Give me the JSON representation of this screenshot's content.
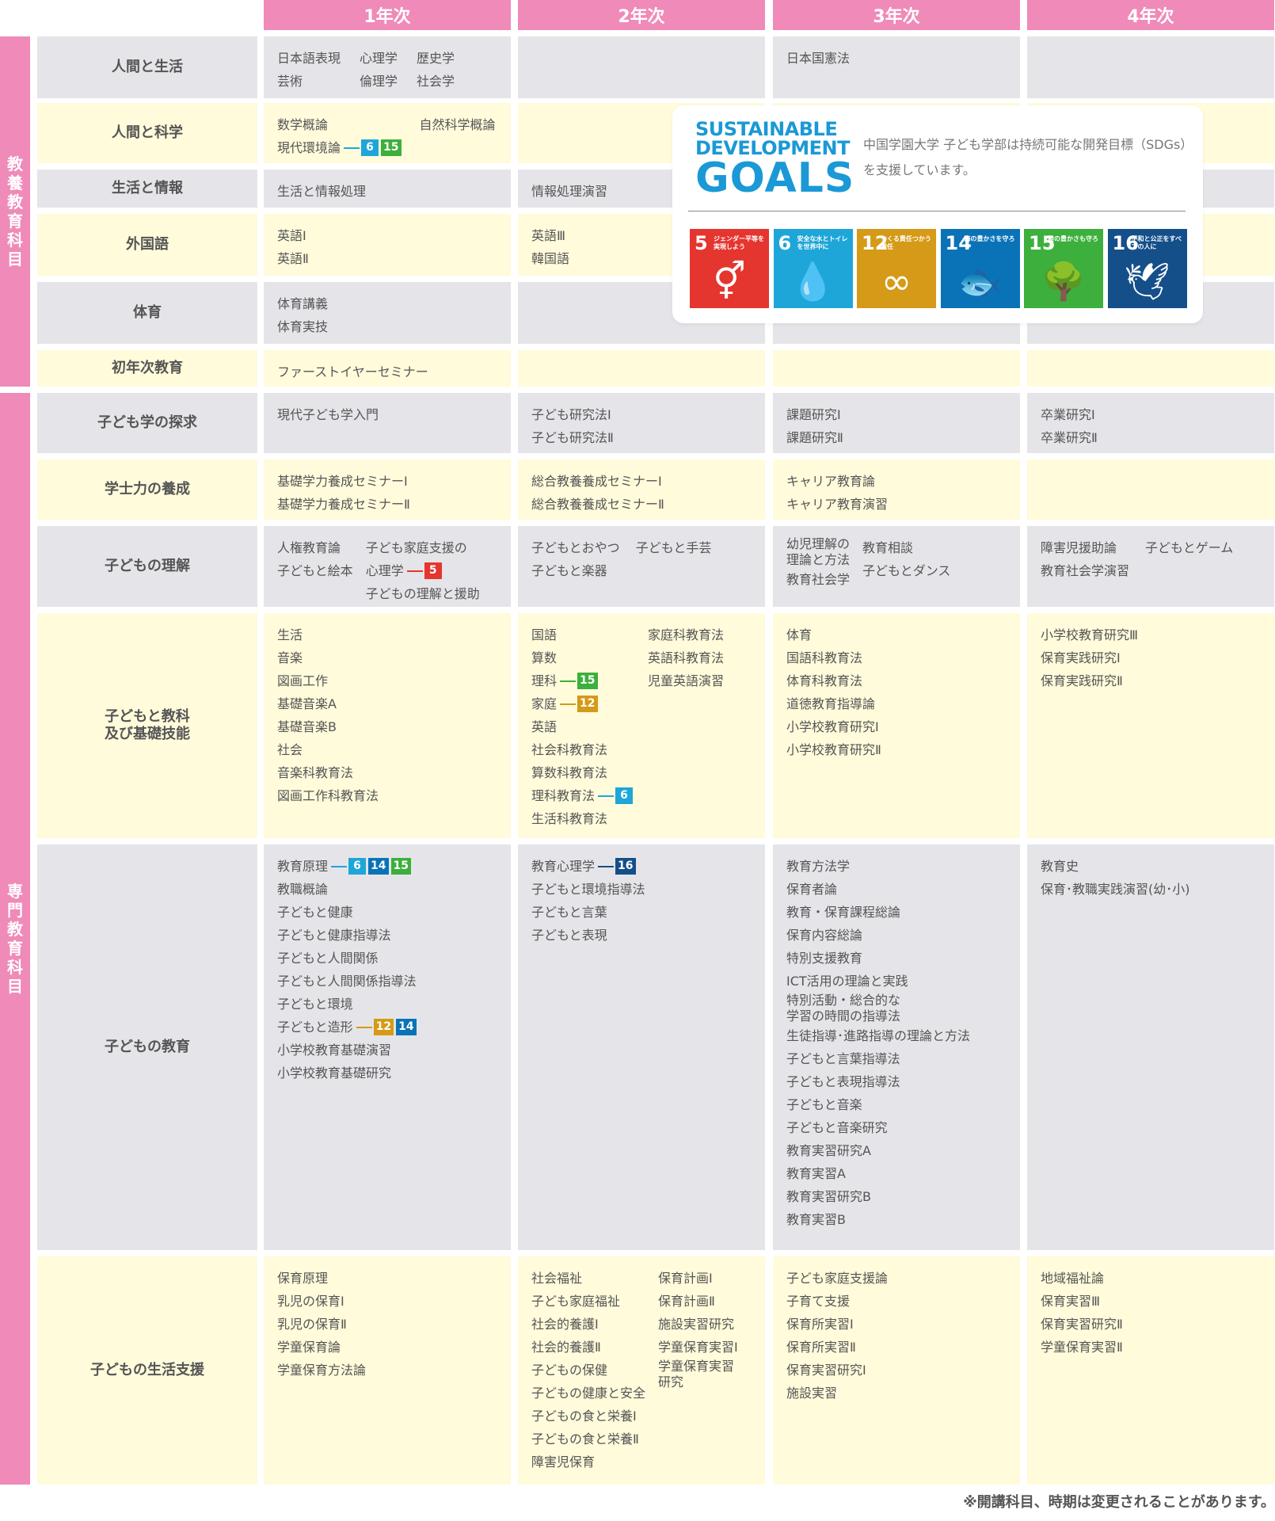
{
  "years": [
    "1年次",
    "2年次",
    "3年次",
    "4年次"
  ],
  "groups": {
    "general": "教養教育科目",
    "specialized": "専門教育科目"
  },
  "colors": {
    "pink": "#ef8ab9",
    "gray_cell": "#e5e5e9",
    "cream_cell": "#fffbdb",
    "sdg5": "#e5352f",
    "sdg6": "#1ea6d9",
    "sdg12": "#d59a17",
    "sdg14": "#0a73b8",
    "sdg15": "#3caf3c",
    "sdg16": "#144f8a"
  },
  "rows": [
    {
      "category": "人間と生活",
      "tone": "gray",
      "y1": {
        "layout": "grid3",
        "items": [
          {
            "t": "日本語表現"
          },
          {
            "t": "心理学"
          },
          {
            "t": "歴史学"
          },
          {
            "t": "芸術"
          },
          {
            "t": "倫理学"
          },
          {
            "t": "社会学"
          }
        ]
      },
      "y2": null,
      "y3": {
        "items": [
          {
            "t": "日本国憲法"
          }
        ]
      },
      "y4": null
    },
    {
      "category": "人間と科学",
      "tone": "cream",
      "y1": {
        "layout": "grid2",
        "items": [
          {
            "t": "数学概論"
          },
          {
            "t": "自然科学概論"
          },
          {
            "t": "現代環境論",
            "s": [
              "6",
              "15"
            ]
          }
        ]
      },
      "y2": null,
      "y3": null,
      "y4": null
    },
    {
      "category": "生活と情報",
      "tone": "gray",
      "y1": {
        "items": [
          {
            "t": "生活と情報処理"
          }
        ]
      },
      "y2": {
        "items": [
          {
            "t": "情報処理演習"
          }
        ]
      },
      "y3": null,
      "y4": null
    },
    {
      "category": "外国語",
      "tone": "cream",
      "y1": {
        "items": [
          {
            "t": "英語Ⅰ"
          },
          {
            "t": "英語Ⅱ"
          }
        ]
      },
      "y2": {
        "items": [
          {
            "t": "英語Ⅲ"
          },
          {
            "t": "韓国語"
          }
        ]
      },
      "y3": null,
      "y4": null
    },
    {
      "category": "体育",
      "tone": "gray",
      "y1": {
        "items": [
          {
            "t": "体育講義"
          },
          {
            "t": "体育実技"
          }
        ]
      },
      "y2": null,
      "y3": null,
      "y4": null
    },
    {
      "category": "初年次教育",
      "tone": "cream",
      "y1": {
        "items": [
          {
            "t": "ファーストイヤーセミナー"
          }
        ]
      },
      "y2": null,
      "y3": null,
      "y4": null
    },
    {
      "category": "子ども学の探求",
      "tone": "gray",
      "y1": {
        "items": [
          {
            "t": "現代子ども学入門"
          }
        ]
      },
      "y2": {
        "items": [
          {
            "t": "子ども研究法Ⅰ"
          },
          {
            "t": "子ども研究法Ⅱ"
          }
        ]
      },
      "y3": {
        "items": [
          {
            "t": "課題研究Ⅰ"
          },
          {
            "t": "課題研究Ⅱ"
          }
        ]
      },
      "y4": {
        "items": [
          {
            "t": "卒業研究Ⅰ"
          },
          {
            "t": "卒業研究Ⅱ"
          }
        ]
      }
    },
    {
      "category": "学士力の養成",
      "tone": "cream",
      "y1": {
        "items": [
          {
            "t": "基礎学力養成セミナーⅠ"
          },
          {
            "t": "基礎学力養成セミナーⅡ"
          }
        ]
      },
      "y2": {
        "items": [
          {
            "t": "総合教養養成セミナーⅠ"
          },
          {
            "t": "総合教養養成セミナーⅡ"
          }
        ]
      },
      "y3": {
        "items": [
          {
            "t": "キャリア教育論"
          },
          {
            "t": "キャリア教育演習"
          }
        ]
      },
      "y4": null
    },
    {
      "category": "子どもの理解",
      "tone": "gray",
      "y1": {
        "layout": "cols",
        "cols": [
          [
            {
              "t": "人権教育論"
            },
            {
              "t": "子どもと絵本"
            }
          ],
          [
            {
              "t": "子ども家庭支援の"
            },
            {
              "t": "心理学",
              "s": [
                "5"
              ]
            },
            {
              "t": "子どもの理解と援助"
            }
          ]
        ]
      },
      "y2": {
        "layout": "grid2",
        "items": [
          {
            "t": "子どもとおやつ"
          },
          {
            "t": "子どもと手芸"
          },
          {
            "t": "子どもと楽器"
          }
        ]
      },
      "y3": {
        "layout": "cols",
        "cols": [
          [
            {
              "t": "幼児理解の\n理論と方法"
            },
            {
              "t": "教育社会学"
            }
          ],
          [
            {
              "t": "教育相談"
            },
            {
              "t": "子どもとダンス"
            }
          ]
        ]
      },
      "y4": {
        "layout": "grid2",
        "items": [
          {
            "t": "障害児援助論"
          },
          {
            "t": "子どもとゲーム"
          },
          {
            "t": "教育社会学演習"
          }
        ]
      }
    },
    {
      "category": "子どもと教科\n及び基礎技能",
      "tone": "cream",
      "y1": {
        "items": [
          {
            "t": "生活"
          },
          {
            "t": "音楽"
          },
          {
            "t": "図画工作"
          },
          {
            "t": "基礎音楽A"
          },
          {
            "t": "基礎音楽B"
          },
          {
            "t": "社会"
          },
          {
            "t": "音楽科教育法"
          },
          {
            "t": "図画工作科教育法"
          }
        ]
      },
      "y2": {
        "layout": "cols",
        "cols": [
          [
            {
              "t": "国語"
            },
            {
              "t": "算数"
            },
            {
              "t": "理科",
              "s": [
                "15"
              ]
            },
            {
              "t": "家庭",
              "s": [
                "12"
              ]
            },
            {
              "t": "英語"
            },
            {
              "t": "社会科教育法"
            },
            {
              "t": "算数科教育法"
            },
            {
              "t": "理科教育法",
              "s": [
                "6"
              ]
            },
            {
              "t": "生活科教育法"
            }
          ],
          [
            {
              "t": "家庭科教育法"
            },
            {
              "t": "英語科教育法"
            },
            {
              "t": "児童英語演習"
            }
          ]
        ]
      },
      "y3": {
        "items": [
          {
            "t": "体育"
          },
          {
            "t": "国語科教育法"
          },
          {
            "t": "体育科教育法"
          },
          {
            "t": "道徳教育指導論"
          },
          {
            "t": "小学校教育研究Ⅰ"
          },
          {
            "t": "小学校教育研究Ⅱ"
          }
        ]
      },
      "y4": {
        "items": [
          {
            "t": "小学校教育研究Ⅲ"
          },
          {
            "t": "保育実践研究Ⅰ"
          },
          {
            "t": "保育実践研究Ⅱ"
          }
        ]
      }
    },
    {
      "category": "子どもの教育",
      "tone": "gray",
      "y1": {
        "items": [
          {
            "t": "教育原理",
            "s": [
              "6",
              "14",
              "15"
            ]
          },
          {
            "t": "教職概論"
          },
          {
            "t": "子どもと健康"
          },
          {
            "t": "子どもと健康指導法"
          },
          {
            "t": "子どもと人間関係"
          },
          {
            "t": "子どもと人間関係指導法"
          },
          {
            "t": "子どもと環境"
          },
          {
            "t": "子どもと造形",
            "s": [
              "12",
              "14"
            ]
          },
          {
            "t": "小学校教育基礎演習"
          },
          {
            "t": "小学校教育基礎研究"
          }
        ]
      },
      "y2": {
        "items": [
          {
            "t": "教育心理学",
            "s": [
              "16"
            ]
          },
          {
            "t": "子どもと環境指導法"
          },
          {
            "t": "子どもと言葉"
          },
          {
            "t": "子どもと表現"
          }
        ]
      },
      "y3": {
        "items": [
          {
            "t": "教育方法学"
          },
          {
            "t": "保育者論"
          },
          {
            "t": "教育・保育課程総論"
          },
          {
            "t": "保育内容総論"
          },
          {
            "t": "特別支援教育"
          },
          {
            "t": "ICT活用の理論と実践"
          },
          {
            "t": "特別活動・総合的な\n学習の時間の指導法"
          },
          {
            "t": "生徒指導･進路指導の理論と方法"
          },
          {
            "t": "子どもと言葉指導法"
          },
          {
            "t": "子どもと表現指導法"
          },
          {
            "t": "子どもと音楽"
          },
          {
            "t": "子どもと音楽研究"
          },
          {
            "t": "教育実習研究A"
          },
          {
            "t": "教育実習A"
          },
          {
            "t": "教育実習研究B"
          },
          {
            "t": "教育実習B"
          }
        ]
      },
      "y4": {
        "items": [
          {
            "t": "教育史"
          },
          {
            "t": "保育･教職実践演習(幼･小)"
          }
        ]
      }
    },
    {
      "category": "子どもの生活支援",
      "tone": "cream",
      "y1": {
        "items": [
          {
            "t": "保育原理"
          },
          {
            "t": "乳児の保育Ⅰ"
          },
          {
            "t": "乳児の保育Ⅱ"
          },
          {
            "t": "学童保育論"
          },
          {
            "t": "学童保育方法論"
          }
        ]
      },
      "y2": {
        "layout": "cols",
        "cols": [
          [
            {
              "t": "社会福祉"
            },
            {
              "t": "子ども家庭福祉"
            },
            {
              "t": "社会的養護Ⅰ"
            },
            {
              "t": "社会的養護Ⅱ"
            },
            {
              "t": "子どもの保健"
            },
            {
              "t": "子どもの健康と安全"
            },
            {
              "t": "子どもの食と栄養Ⅰ"
            },
            {
              "t": "子どもの食と栄養Ⅱ"
            },
            {
              "t": "障害児保育"
            }
          ],
          [
            {
              "t": "保育計画Ⅰ"
            },
            {
              "t": "保育計画Ⅱ"
            },
            {
              "t": "施設実習研究"
            },
            {
              "t": "学童保育実習Ⅰ"
            },
            {
              "t": "学童保育実習\n研究"
            }
          ]
        ]
      },
      "y3": {
        "items": [
          {
            "t": "子ども家庭支援論"
          },
          {
            "t": "子育て支援"
          },
          {
            "t": "保育所実習Ⅰ"
          },
          {
            "t": "保育所実習Ⅱ"
          },
          {
            "t": "保育実習研究Ⅰ"
          },
          {
            "t": "施設実習"
          }
        ]
      },
      "y4": {
        "items": [
          {
            "t": "地域福祉論"
          },
          {
            "t": "保育実習Ⅲ"
          },
          {
            "t": "保育実習研究Ⅱ"
          },
          {
            "t": "学童保育実習Ⅱ"
          }
        ]
      }
    }
  ],
  "sdg_panel": {
    "logo_line1": "SUSTAINABLE",
    "logo_line2": "DEVELOPMENT",
    "logo_line3": "GOALS",
    "text": "中国学園大学 子ども学部は持続可能な開発目標（SDGs）を支援しています。",
    "icons": [
      {
        "num": "5",
        "label": "ジェンダー平等を実現しよう",
        "glyph": "⚥",
        "icon": "gender-equality-icon",
        "color": "#e5352f"
      },
      {
        "num": "6",
        "label": "安全な水とトイレを世界中に",
        "glyph": "💧",
        "icon": "clean-water-icon",
        "color": "#1ea6d9"
      },
      {
        "num": "12",
        "label": "つくる責任つかう責任",
        "glyph": "∞",
        "icon": "infinity-icon",
        "color": "#d59a17"
      },
      {
        "num": "14",
        "label": "海の豊かさを守ろう",
        "glyph": "🐟",
        "icon": "fish-icon",
        "color": "#0a73b8"
      },
      {
        "num": "15",
        "label": "陸の豊かさも守ろう",
        "glyph": "🌳",
        "icon": "tree-icon",
        "color": "#3caf3c"
      },
      {
        "num": "16",
        "label": "平和と公正をすべての人に",
        "glyph": "🕊",
        "icon": "dove-icon",
        "color": "#144f8a"
      }
    ]
  },
  "footnote": "※開講科目、時期は変更されることがあります。"
}
